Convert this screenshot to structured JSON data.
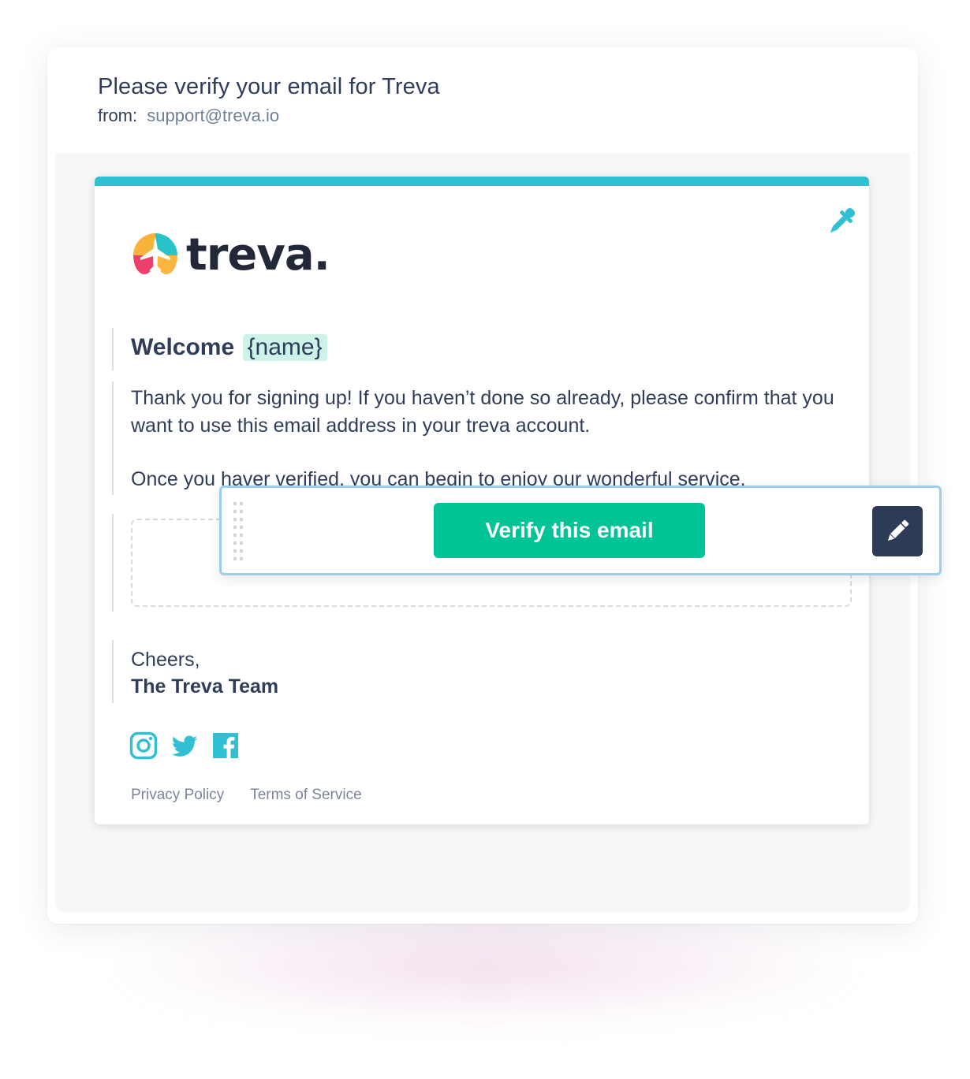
{
  "email": {
    "subject": "Please verify your email for Treva",
    "from_label": "from:",
    "from_address": "support@treva.io"
  },
  "card": {
    "logo_text": "treva.",
    "welcome_text": "Welcome",
    "name_tag": "{name}",
    "paragraph_1": "Thank you for signing up! If you haven’t done so already, please confirm that you want to use this email address in your treva account.",
    "paragraph_2": "Once you haver verified, you can begin to enjoy our wonderful service.",
    "signoff": "Cheers,",
    "signature": "The Treva Team",
    "socials": [
      "instagram-icon",
      "twitter-icon",
      "facebook-icon"
    ],
    "footer_links": [
      "Privacy Policy",
      "Terms of Service"
    ]
  },
  "button_block": {
    "verify_label": "Verify this email",
    "edit_icon": "pencil-icon",
    "drag_icon": "drag-handle-icon"
  },
  "colors": {
    "accent_teal": "#31bfd2",
    "button_green": "#00c396",
    "edit_button": "#2e3b57",
    "selection_border": "#9fcdf0",
    "tag_bg": "#cdf2e8"
  }
}
